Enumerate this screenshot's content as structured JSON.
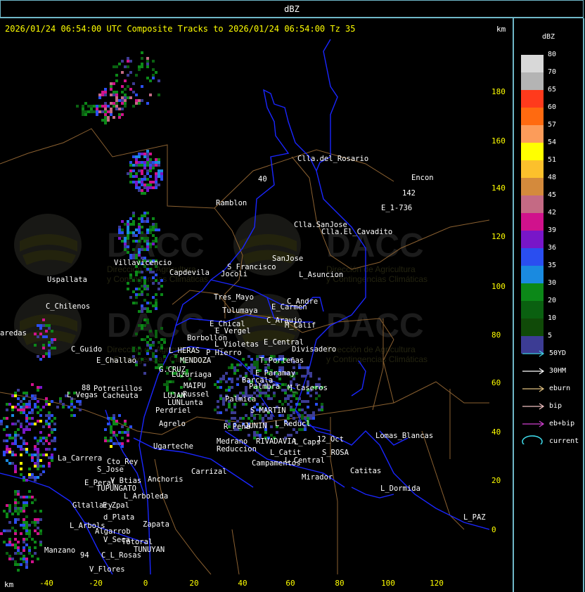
{
  "window_title": "dBZ",
  "header": {
    "title": "2026/01/24 06:54:00 UTC Composite Tracks to 2026/01/24 06:54:00 Tz 35",
    "unit": "km"
  },
  "axes": {
    "y_unit": "km",
    "x_unit": "km",
    "y_ticks": [
      "180",
      "160",
      "140",
      "120",
      "100",
      "80",
      "60",
      "40",
      "20",
      "0"
    ],
    "x_ticks": [
      "-40",
      "-20",
      "0",
      "20",
      "40",
      "60",
      "80",
      "100",
      "120"
    ]
  },
  "legend": {
    "title": "dBZ",
    "scale": [
      {
        "value": "80",
        "color": "#d8d8d8"
      },
      {
        "value": "70",
        "color": "#b4b4b4"
      },
      {
        "value": "65",
        "color": "#ff3a1c"
      },
      {
        "value": "60",
        "color": "#ff6a10"
      },
      {
        "value": "57",
        "color": "#fc9c5a"
      },
      {
        "value": "54",
        "color": "#ffff00"
      },
      {
        "value": "51",
        "color": "#fcc02c"
      },
      {
        "value": "48",
        "color": "#d48a3c"
      },
      {
        "value": "45",
        "color": "#c46a84"
      },
      {
        "value": "42",
        "color": "#d0128c"
      },
      {
        "value": "39",
        "color": "#7816c8"
      },
      {
        "value": "36",
        "color": "#2a4ef0"
      },
      {
        "value": "35",
        "color": "#1a8ae0"
      },
      {
        "value": "30",
        "color": "#0c8818"
      },
      {
        "value": "20",
        "color": "#0a6010"
      },
      {
        "value": "10",
        "color": "#104a08"
      },
      {
        "value": "5",
        "color": "#3c3c94"
      }
    ],
    "tracks": [
      {
        "label": "50YD",
        "color": "#40d0e0"
      },
      {
        "label": "30HM",
        "color": "#ffffff"
      },
      {
        "label": "eburn",
        "color": "#e0c080"
      },
      {
        "label": "bip",
        "color": "#f0c0c0"
      },
      {
        "label": "eb+bip",
        "color": "#d040d0"
      }
    ],
    "current_label": "current",
    "current_color": "#40e0f0"
  },
  "watermark": {
    "name": "DACC",
    "line1": "Dirección de Agricultura",
    "line2": "y Contingencias Climáticas"
  },
  "places": [
    "Clla.del_Rosario",
    "Encon",
    "142",
    "E_1-736",
    "Ramblon",
    "40",
    "Clla.SanJose",
    "Clla.El_Cavadito",
    "Villavicencio",
    "S_Francisco",
    "SanJose",
    "Capdevila",
    "Jocoli",
    "L_Asuncion",
    "Uspallata",
    "Tres_Mayo",
    "C_Andre",
    "C_Chilenos",
    "Tulumaya",
    "E_Carmen",
    "E_Chical",
    "C_Araujo",
    "M_Calif",
    "aredas",
    "E_Vergel",
    "Borbollon",
    "L_Violetas",
    "E_Central",
    "Divisadero",
    "C_Guido",
    "L_HERAS",
    "P_Hierro",
    "E_Challao",
    "MENDOZA",
    "T_Porteñas",
    "G.CRUZ",
    "Luzuriaga",
    "E_Paramay",
    "Barcala",
    "MAIPU",
    "Palmbra",
    "M_Caseros",
    "88",
    "Potrerillos",
    "Russel",
    "L_Vegas",
    "Cacheuta",
    "LUJAN",
    "Palmica",
    "LUNLunta",
    "Perdriel",
    "S_MARTIN",
    "Agrelo",
    "R_Peña",
    "JUNIN",
    "L_Reducl",
    "Ugarteche",
    "Medrano",
    "RIVADAVIA",
    "L_Caps",
    "12_Oct",
    "Lomas_Blancas",
    "Reduccion",
    "S_ROSA",
    "L_Catit",
    "La_Carrera",
    "Cto_Rey",
    "S_Jose",
    "Campamentos",
    "L_Central",
    "Carrizal",
    "Catitas",
    "V_Btias",
    "Anchoris",
    "E_Peral",
    "TUPUNGATO",
    "Mirador",
    "L_Dormida",
    "L_Arboleda",
    "E_Zpal",
    "Gltallary",
    "d_Plata",
    "L_Arbols",
    "L_PAZ",
    "Zapata",
    "Algarrob",
    "V_Seca",
    "Totoral",
    "TUNUYAN",
    "Manzano",
    "C_L_Rosas",
    "94",
    "V_Flores"
  ]
}
